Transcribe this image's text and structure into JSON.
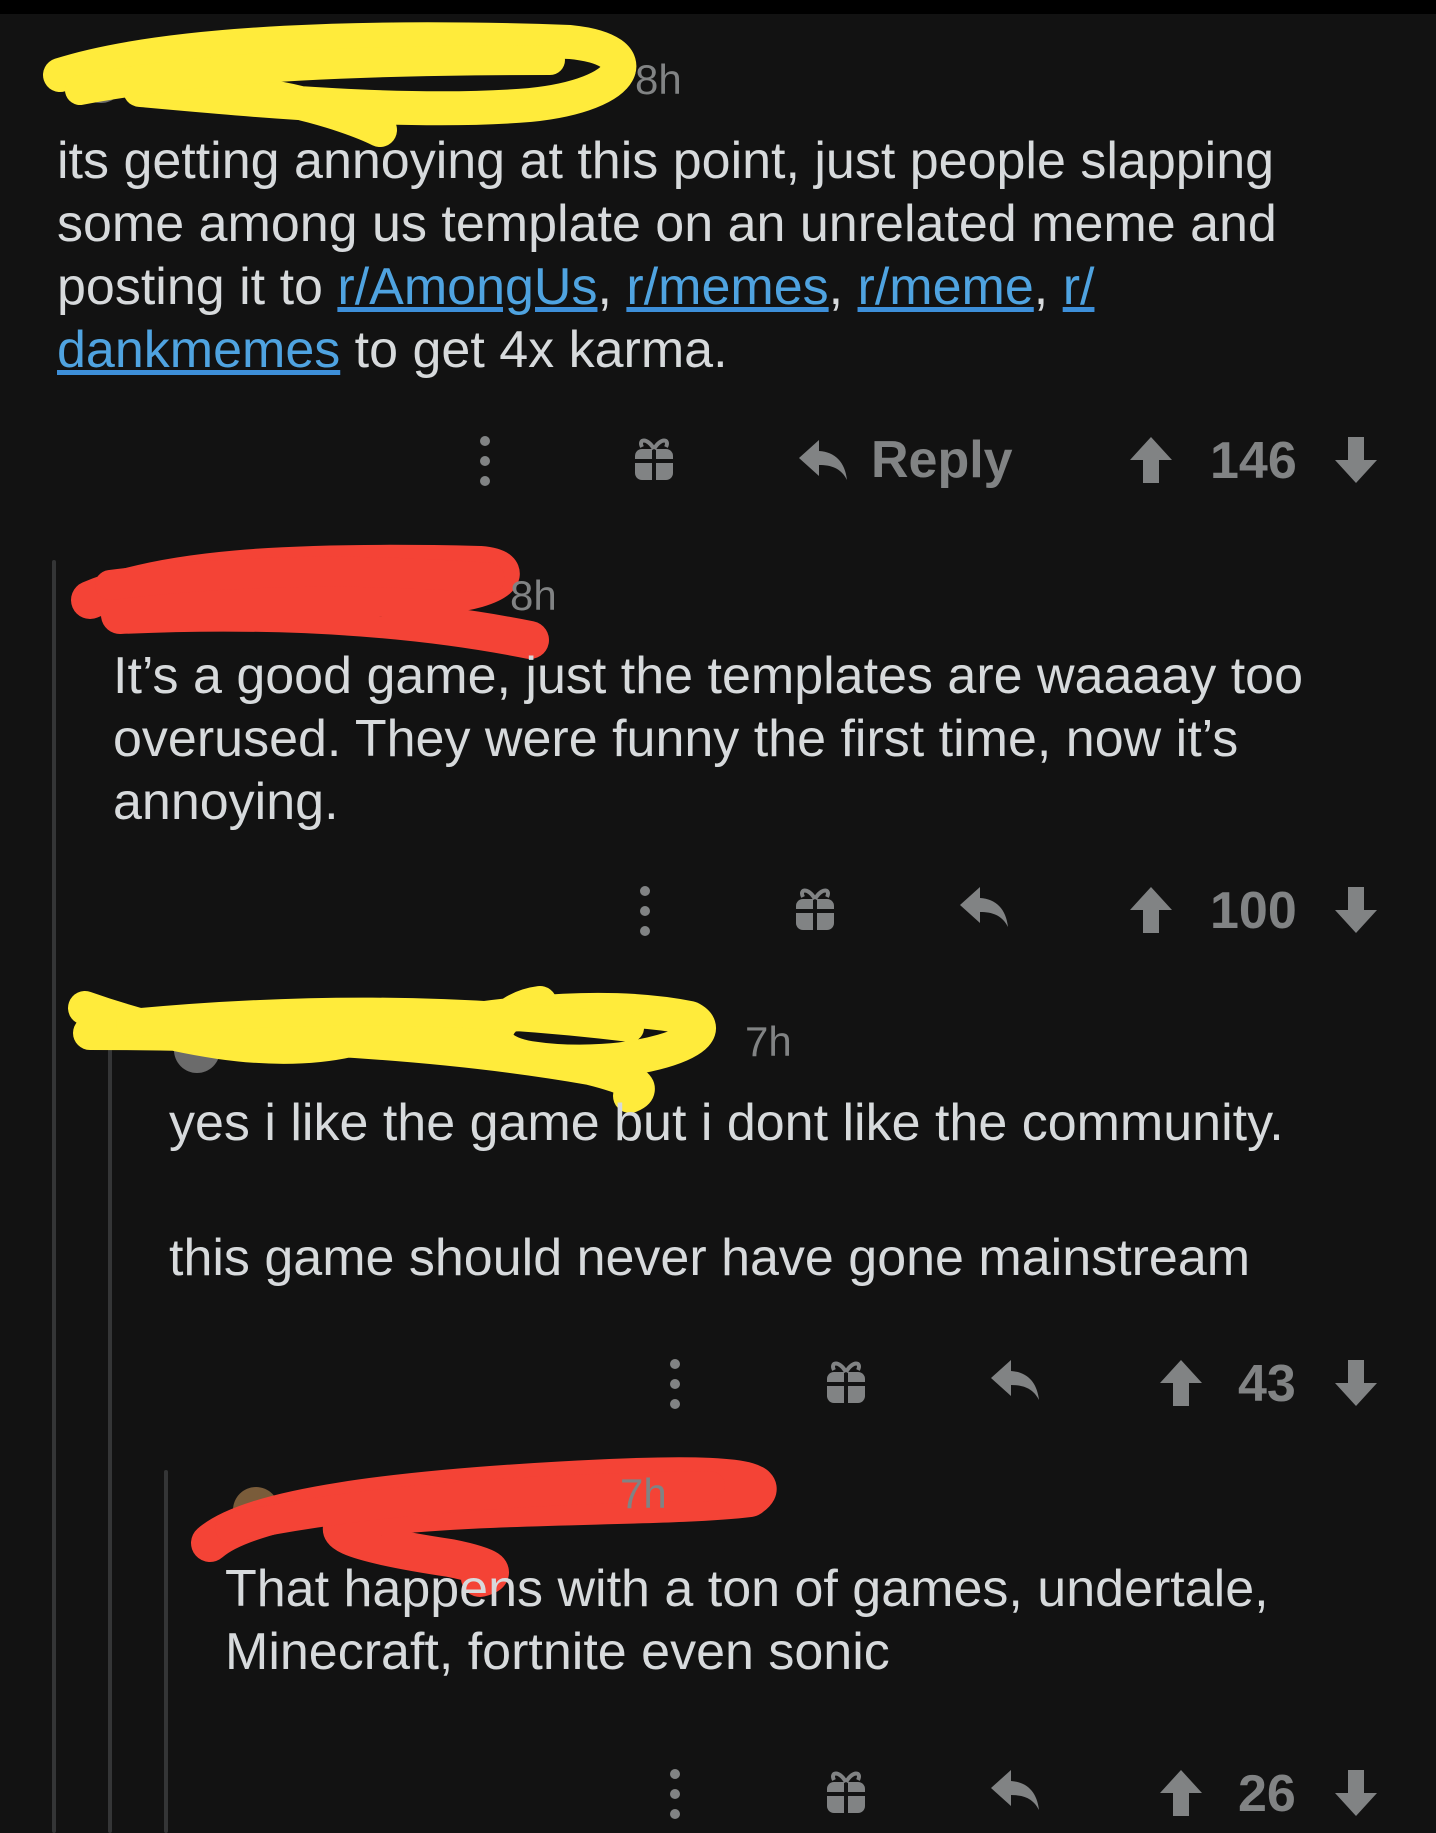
{
  "colors": {
    "background": "#121212",
    "text": "#d7dadc",
    "muted": "#818384",
    "link": "#4fa3e0",
    "thread_line": "#343536",
    "redact_yellow": "#ffeb3b",
    "redact_red": "#f44336"
  },
  "comments": [
    {
      "time": "8h",
      "body": {
        "text_before": "its getting annoying at this point, just people slapping some among us template on an unrelated meme and posting it to ",
        "links": [
          "r/AmongUs",
          "r/memes",
          "r/meme",
          "r/ dankmemes"
        ],
        "sep1": ", ",
        "sep2": ", ",
        "sep3": ", ",
        "text_after": " to get 4x karma."
      },
      "reply_label": "Reply",
      "score": "146",
      "redaction_color": "yellow",
      "icons": [
        "more-icon",
        "award-icon",
        "reply-icon",
        "upvote-icon",
        "downvote-icon"
      ]
    },
    {
      "time": "8h",
      "body": {
        "p1": "It’s a good game, just the templates are waaaay too overused. They were funny the first time, now it’s annoying."
      },
      "score": "100",
      "redaction_color": "red"
    },
    {
      "time": "7h",
      "body": {
        "p1": "yes i like the game but i dont like the community.",
        "p2": "this game should never have gone mainstream"
      },
      "score": "43",
      "redaction_color": "yellow"
    },
    {
      "time": "7h",
      "body": {
        "p1": "That happens with a ton of games, undertale, Minecraft, fortnite even sonic"
      },
      "score": "26",
      "redaction_color": "red"
    }
  ]
}
